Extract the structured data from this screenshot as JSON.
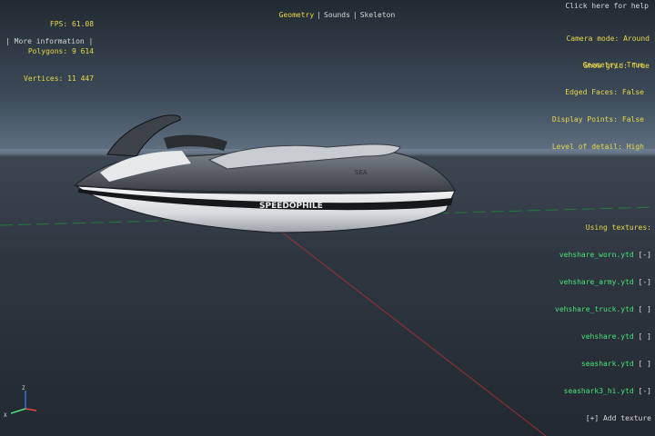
{
  "stats": {
    "fps": "FPS: 61.08",
    "polygons": "Polygons: 9 614",
    "vertices": "Vertices: 11 447"
  },
  "more_info": "| More information |",
  "modes": {
    "geometry": "Geometry",
    "sounds": "Sounds",
    "skeleton": "Skeleton",
    "separator": "|"
  },
  "help": "Click here for help",
  "camera": {
    "mode": "Camera mode: Around",
    "grid": "Show grid: True"
  },
  "display": {
    "geometry": "Geometry: True",
    "edged_faces": "Edged Faces: False",
    "display_points": "Display Points: False",
    "lod": "Level of detail: High"
  },
  "textures": {
    "header": "Using textures:",
    "items": [
      {
        "name": "vehshare_worn.ytd",
        "toggle": "[-]"
      },
      {
        "name": "vehshare_army.ytd",
        "toggle": "[-]"
      },
      {
        "name": "vehshare_truck.ytd",
        "toggle": "[ ]"
      },
      {
        "name": "vehshare.ytd",
        "toggle": "[ ]"
      },
      {
        "name": "seashark.ytd",
        "toggle": "[ ]"
      },
      {
        "name": "seashark3_hi.ytd",
        "toggle": "[-]"
      }
    ],
    "add": "[+] Add texture"
  },
  "model": {
    "brand_text": "SPEEDOPHILE",
    "logo_text": "SEA",
    "colors": {
      "hull": "#e9eaec",
      "stripe": "#16181b",
      "seat": "#9aa0a6"
    }
  },
  "axis_labels": {
    "x": "X",
    "z": "Z"
  }
}
